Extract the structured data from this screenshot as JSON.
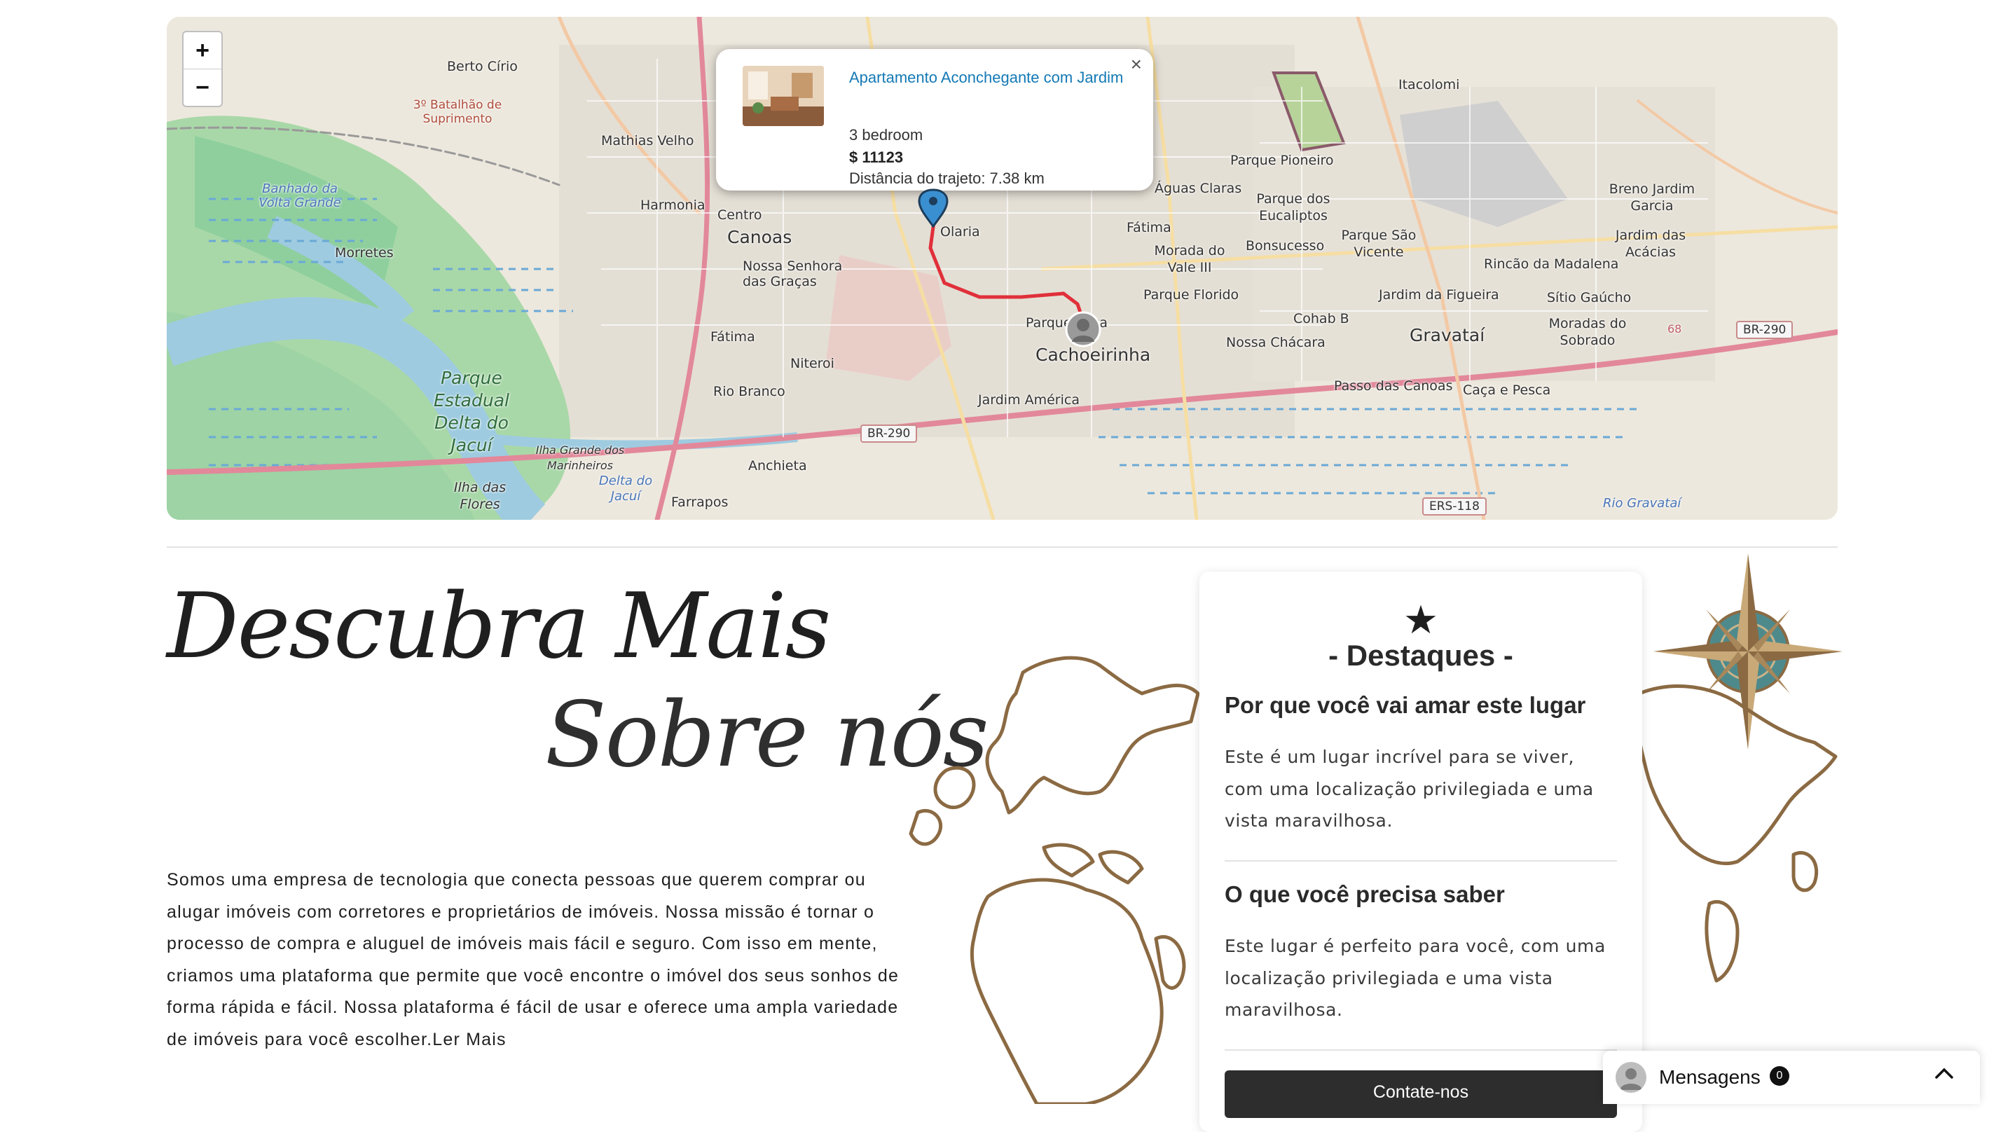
{
  "map": {
    "zoom_in": "+",
    "zoom_out": "−",
    "labels": {
      "berto_cirio": "Berto Círio",
      "batalhao": "3º Batalhão de Suprimento",
      "mathias_velho": "Mathias Velho",
      "harmonia": "Harmonia",
      "centro": "Centro",
      "canoas": "Canoas",
      "nossa_senhora": "Nossa Senhora das Graças",
      "fatima_w": "Fátima",
      "niteroi": "Niteroi",
      "rio_branco": "Rio Branco",
      "anchieta": "Anchieta",
      "farrapos": "Farrapos",
      "morretes": "Morretes",
      "banhado": "Banhado da Volta Grande",
      "parque_delta": "Parque Estadual Delta do Jacuí",
      "ilha_grande": "Ilha Grande dos Marinheiros",
      "delta_jacui": "Delta do Jacuí",
      "ilha_flores": "Ilha das Flores",
      "olaria": "Olaria",
      "jardim_america": "Jardim América",
      "cachoeirinha": "Cachoeirinha",
      "parque_silva": "Parque Silva",
      "fatima_e": "Fátima",
      "aguas_claras": "Águas Claras",
      "morada_vale": "Morada do Vale III",
      "parque_florido": "Parque Florido",
      "bonsucesso": "Bonsucesso",
      "parque_eucaliptos": "Parque dos Eucaliptos",
      "parque_pioneiro": "Parque Pioneiro",
      "itacolomi": "Itacolomi",
      "parque_sao_vicente": "Parque São Vicente",
      "cohab": "Cohab B",
      "nossa_chacara": "Nossa Chácara",
      "gravatai": "Gravataí",
      "jardim_figueira": "Jardim da Figueira",
      "rincao": "Rincão da Madalena",
      "breno": "Breno Jardim Garcia",
      "jardim_acacias": "Jardim das Acácias",
      "sitio_gaucho": "Sítio Gaúcho",
      "moradas_sobrado": "Moradas do Sobrado",
      "passo_canoas": "Passo das Canoas",
      "caca_pesca": "Caça e Pesca",
      "rio_gravatai": "Rio Gravataí",
      "br290_a": "BR-290",
      "br290_b": "BR-290",
      "ers118": "ERS-118",
      "road68": "68"
    },
    "popup": {
      "title": "Apartamento Aconchegante com Jardim",
      "bedrooms": "3 bedroom",
      "price": "$ 11123",
      "distance": "Distância do trajeto: 7.38 km",
      "close": "×"
    }
  },
  "hero": {
    "title_line1": "Descubra Mais",
    "title_line2": "Sobre nós",
    "about_text": "Somos uma empresa de tecnologia que conecta pessoas que querem comprar ou alugar imóveis com corretores e proprietários de imóveis. Nossa missão é tornar o processo de compra e aluguel de imóveis mais fácil e seguro. Com isso em mente, criamos uma plataforma que permite que você encontre o imóvel dos seus sonhos de forma rápida e fácil. Nossa plataforma é fácil de usar e oferece uma ampla variedade de imóveis para você escolher.",
    "read_more": "Ler Mais"
  },
  "highlights": {
    "icon": "star-icon",
    "title": "- Destaques -",
    "section1_title": "Por que você vai amar este lugar",
    "section1_text": "Este é um lugar incrível para se viver, com uma localização privilegiada e uma vista maravilhosa.",
    "section2_title": "O que você precisa saber",
    "section2_text": "Este lugar é perfeito para você, com uma localização privilegiada e uma vista maravilhosa.",
    "cta": "Contate-nos"
  },
  "messages": {
    "label": "Mensagens",
    "count": "0"
  },
  "colors": {
    "link": "#1479b5",
    "route": "#e0303a",
    "decor": "#8b6a43",
    "button": "#2d2d2d"
  }
}
